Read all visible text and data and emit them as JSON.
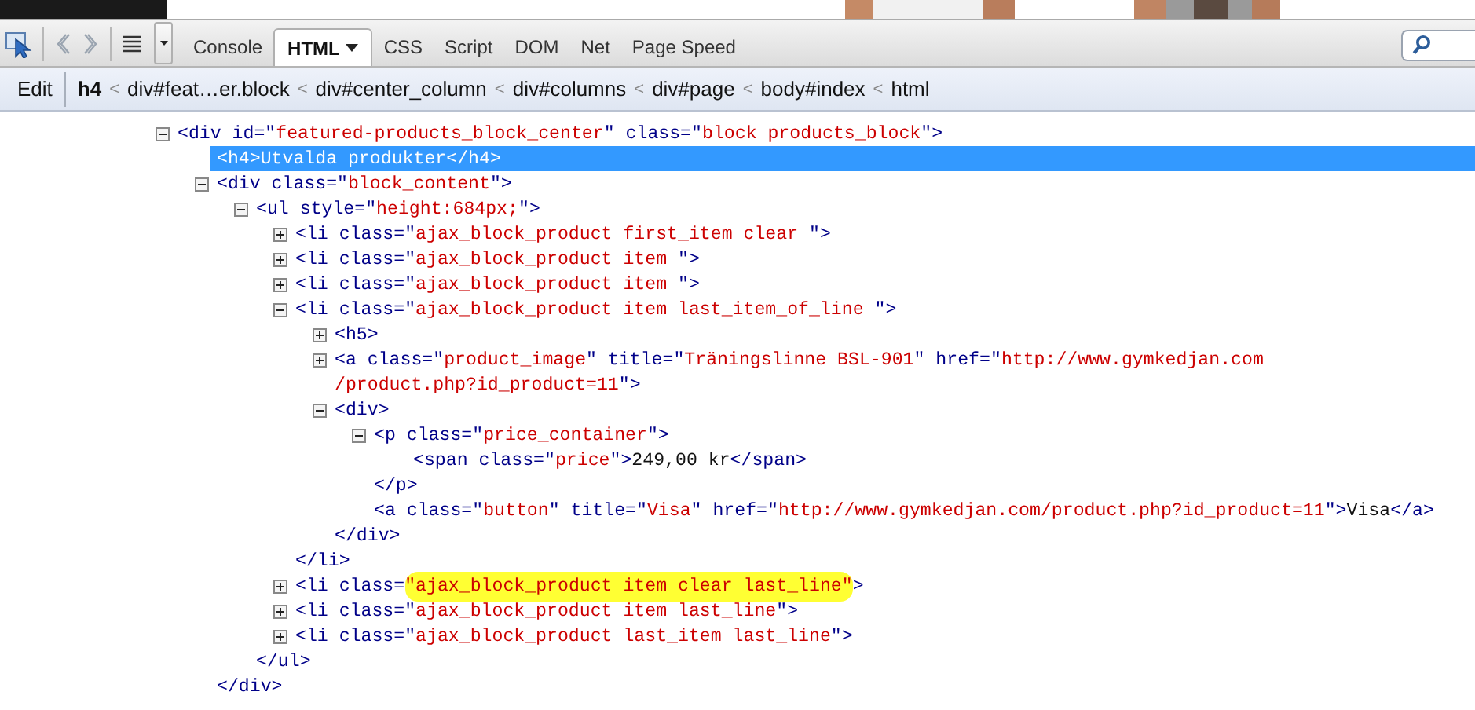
{
  "toolbar": {
    "tabs": [
      {
        "label": "Console",
        "selected": false,
        "menu": false
      },
      {
        "label": "HTML",
        "selected": true,
        "menu": true
      },
      {
        "label": "CSS",
        "selected": false,
        "menu": false
      },
      {
        "label": "Script",
        "selected": false,
        "menu": false
      },
      {
        "label": "DOM",
        "selected": false,
        "menu": false
      },
      {
        "label": "Net",
        "selected": false,
        "menu": false
      },
      {
        "label": "Page Speed",
        "selected": false,
        "menu": false
      }
    ]
  },
  "breadcrumb": {
    "edit": "Edit",
    "items": [
      {
        "label": "h4",
        "separator": "<",
        "selected": true
      },
      {
        "label": "div#feat…er.block",
        "separator": "<",
        "selected": false
      },
      {
        "label": "div#center_column",
        "separator": "<",
        "selected": false
      },
      {
        "label": "div#columns",
        "separator": "<",
        "selected": false
      },
      {
        "label": "div#page",
        "separator": "<",
        "selected": false
      },
      {
        "label": "body#index",
        "separator": "<",
        "selected": false
      },
      {
        "label": "html",
        "selected": false
      }
    ]
  },
  "tree": {
    "nodes": [
      {
        "expanded": true,
        "selected": false,
        "lines": [
          [
            {
              "kind": "markup",
              "text": "<div id=\""
            },
            {
              "kind": "value",
              "text": "featured-products_block_center"
            },
            {
              "kind": "markup",
              "text": "\" class=\""
            },
            {
              "kind": "value",
              "text": "block products_block"
            },
            {
              "kind": "markup",
              "text": "\">"
            }
          ]
        ],
        "children": [
          {
            "selected": true,
            "lines": [
              [
                {
                  "kind": "markup",
                  "text": "<h4>"
                },
                {
                  "kind": "text",
                  "text": "Utvalda produkter"
                },
                {
                  "kind": "markup",
                  "text": "</h4>"
                }
              ]
            ]
          },
          {
            "expanded": true,
            "selected": false,
            "lines": [
              [
                {
                  "kind": "markup",
                  "text": "<div class=\""
                },
                {
                  "kind": "value",
                  "text": "block_content"
                },
                {
                  "kind": "markup",
                  "text": "\">"
                }
              ]
            ],
            "close": [
              {
                "kind": "markup",
                "text": "</div>"
              }
            ],
            "children": [
              {
                "expanded": true,
                "selected": false,
                "lines": [
                  [
                    {
                      "kind": "markup",
                      "text": "<ul style=\""
                    },
                    {
                      "kind": "value",
                      "text": "height:684px;"
                    },
                    {
                      "kind": "markup",
                      "text": "\">"
                    }
                  ]
                ],
                "close": [
                  {
                    "kind": "markup",
                    "text": "</ul>"
                  }
                ],
                "children": [
                  {
                    "expanded": false,
                    "selected": false,
                    "lines": [
                      [
                        {
                          "kind": "markup",
                          "text": "<li class=\""
                        },
                        {
                          "kind": "value",
                          "text": "ajax_block_product first_item clear "
                        },
                        {
                          "kind": "markup",
                          "text": "\">"
                        }
                      ]
                    ]
                  },
                  {
                    "expanded": false,
                    "selected": false,
                    "lines": [
                      [
                        {
                          "kind": "markup",
                          "text": "<li class=\""
                        },
                        {
                          "kind": "value",
                          "text": "ajax_block_product item "
                        },
                        {
                          "kind": "markup",
                          "text": "\">"
                        }
                      ]
                    ]
                  },
                  {
                    "expanded": false,
                    "selected": false,
                    "lines": [
                      [
                        {
                          "kind": "markup",
                          "text": "<li class=\""
                        },
                        {
                          "kind": "value",
                          "text": "ajax_block_product item "
                        },
                        {
                          "kind": "markup",
                          "text": "\">"
                        }
                      ]
                    ]
                  },
                  {
                    "expanded": true,
                    "selected": false,
                    "lines": [
                      [
                        {
                          "kind": "markup",
                          "text": "<li class=\""
                        },
                        {
                          "kind": "value",
                          "text": "ajax_block_product item last_item_of_line "
                        },
                        {
                          "kind": "markup",
                          "text": "\">"
                        }
                      ]
                    ],
                    "close": [
                      {
                        "kind": "markup",
                        "text": "</li>"
                      }
                    ],
                    "children": [
                      {
                        "expanded": false,
                        "selected": false,
                        "lines": [
                          [
                            {
                              "kind": "markup",
                              "text": "<h5>"
                            }
                          ]
                        ]
                      },
                      {
                        "expanded": false,
                        "selected": false,
                        "lines": [
                          [
                            {
                              "kind": "markup",
                              "text": "<a class=\""
                            },
                            {
                              "kind": "value",
                              "text": "product_image"
                            },
                            {
                              "kind": "markup",
                              "text": "\" title=\""
                            },
                            {
                              "kind": "value",
                              "text": "Träningslinne BSL-901"
                            },
                            {
                              "kind": "markup",
                              "text": "\" href=\""
                            },
                            {
                              "kind": "value",
                              "text": "http://www.gymkedjan.com"
                            }
                          ],
                          [
                            {
                              "kind": "value",
                              "text": "/product.php?id_product=11"
                            },
                            {
                              "kind": "markup",
                              "text": "\">"
                            }
                          ]
                        ]
                      },
                      {
                        "expanded": true,
                        "selected": false,
                        "lines": [
                          [
                            {
                              "kind": "markup",
                              "text": "<div>"
                            }
                          ]
                        ],
                        "close": [
                          {
                            "kind": "markup",
                            "text": "</div>"
                          }
                        ],
                        "children": [
                          {
                            "expanded": true,
                            "selected": false,
                            "lines": [
                              [
                                {
                                  "kind": "markup",
                                  "text": "<p class=\""
                                },
                                {
                                  "kind": "value",
                                  "text": "price_container"
                                },
                                {
                                  "kind": "markup",
                                  "text": "\">"
                                }
                              ]
                            ],
                            "close": [
                              {
                                "kind": "markup",
                                "text": "</p>"
                              }
                            ],
                            "children": [
                              {
                                "selected": false,
                                "lines": [
                                  [
                                    {
                                      "kind": "markup",
                                      "text": "<span class=\""
                                    },
                                    {
                                      "kind": "value",
                                      "text": "price"
                                    },
                                    {
                                      "kind": "markup",
                                      "text": "\">"
                                    },
                                    {
                                      "kind": "text",
                                      "text": "249,00 kr"
                                    },
                                    {
                                      "kind": "markup",
                                      "text": "</span>"
                                    }
                                  ]
                                ]
                              }
                            ]
                          },
                          {
                            "selected": false,
                            "lines": [
                              [
                                {
                                  "kind": "markup",
                                  "text": "<a class=\""
                                },
                                {
                                  "kind": "value",
                                  "text": "button"
                                },
                                {
                                  "kind": "markup",
                                  "text": "\" title=\""
                                },
                                {
                                  "kind": "value",
                                  "text": "Visa"
                                },
                                {
                                  "kind": "markup",
                                  "text": "\" href=\""
                                },
                                {
                                  "kind": "value",
                                  "text": "http://www.gymkedjan.com/product.php?id_product=11"
                                },
                                {
                                  "kind": "markup",
                                  "text": "\">"
                                },
                                {
                                  "kind": "text",
                                  "text": "Visa"
                                },
                                {
                                  "kind": "markup",
                                  "text": "</a>"
                                }
                              ]
                            ]
                          }
                        ]
                      }
                    ]
                  },
                  {
                    "expanded": false,
                    "selected": false,
                    "lines": [
                      [
                        {
                          "kind": "markup",
                          "text": "<li class="
                        },
                        {
                          "kind": "value",
                          "text": "\"ajax_block_product item clear last_line\"",
                          "highlighted": true
                        },
                        {
                          "kind": "markup",
                          "text": ">"
                        }
                      ]
                    ]
                  },
                  {
                    "expanded": false,
                    "selected": false,
                    "lines": [
                      [
                        {
                          "kind": "markup",
                          "text": "<li class=\""
                        },
                        {
                          "kind": "value",
                          "text": "ajax_block_product item last_line"
                        },
                        {
                          "kind": "markup",
                          "text": "\">"
                        }
                      ]
                    ]
                  },
                  {
                    "expanded": false,
                    "selected": false,
                    "lines": [
                      [
                        {
                          "kind": "markup",
                          "text": "<li class=\""
                        },
                        {
                          "kind": "value",
                          "text": "ajax_block_product last_item last_line"
                        },
                        {
                          "kind": "markup",
                          "text": "\">"
                        }
                      ]
                    ]
                  }
                ]
              }
            ]
          }
        ]
      }
    ]
  }
}
